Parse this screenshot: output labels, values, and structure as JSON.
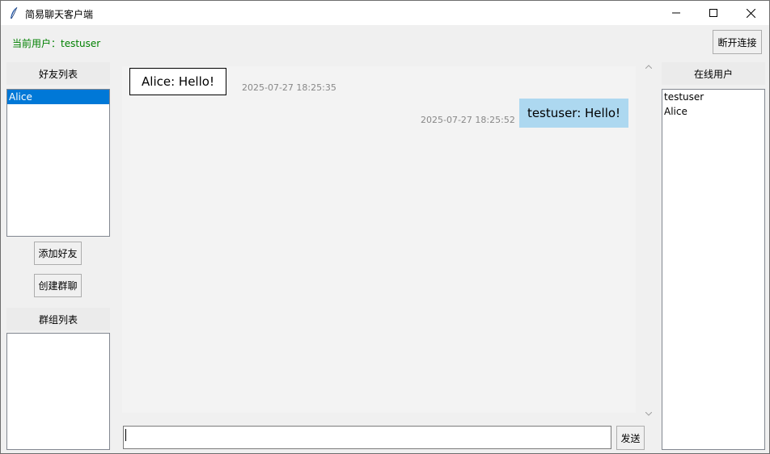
{
  "window": {
    "title": "简易聊天客户端",
    "icon": "feather-icon",
    "controls": [
      "minimize-icon",
      "maximize-icon",
      "close-icon"
    ]
  },
  "header": {
    "current_user": "当前用户：testuser",
    "disconnect_label": "断开连接"
  },
  "left_panel": {
    "friends_title": "好友列表",
    "friends": [
      {
        "name": "Alice",
        "selected": true
      }
    ],
    "add_friend_label": "添加好友",
    "create_group_label": "创建群聊",
    "groups_title": "群组列表",
    "groups": []
  },
  "chat": {
    "messages": [
      {
        "side": "left",
        "text": "Alice: Hello!",
        "time": "2025-07-27 18:25:35"
      },
      {
        "side": "right",
        "text": "testuser: Hello!",
        "time": "2025-07-27 18:25:52"
      }
    ],
    "input_value": "",
    "send_label": "发送"
  },
  "right_panel": {
    "online_title": "在线用户",
    "online_users": [
      "testuser",
      "Alice"
    ]
  },
  "colors": {
    "current_user_text": "#008000",
    "selected_item_bg": "#0078d7",
    "sent_bubble_bg": "#add8f0",
    "timestamp_text": "#888888"
  }
}
